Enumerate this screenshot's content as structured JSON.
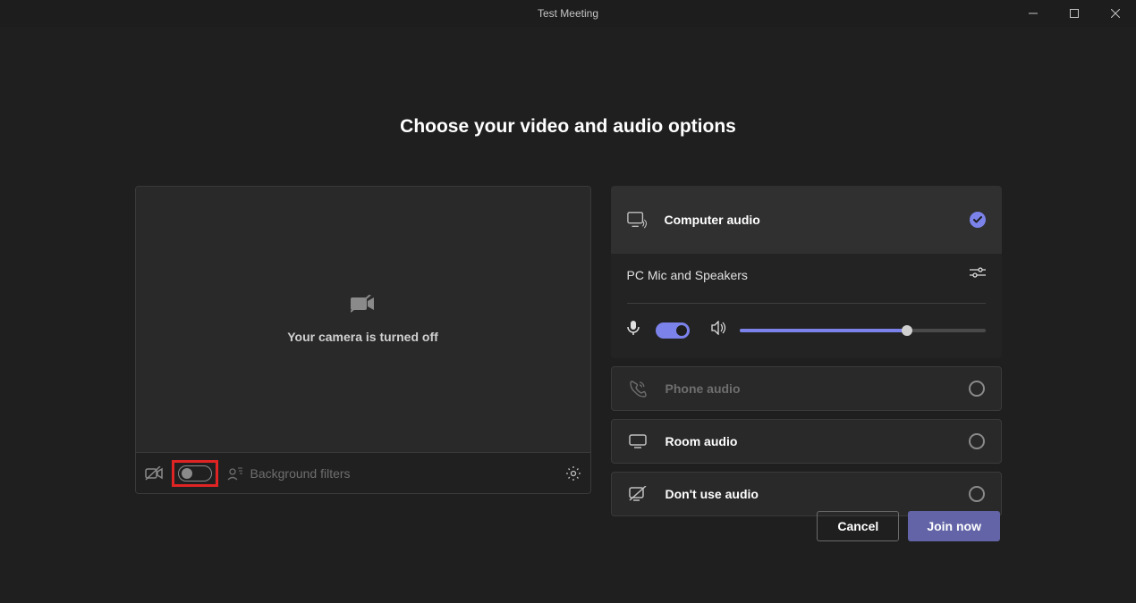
{
  "window": {
    "title": "Test Meeting"
  },
  "heading": "Choose your video and audio options",
  "video": {
    "camera_off_text": "Your camera is turned off",
    "background_filters_label": "Background filters",
    "camera_toggle_on": false
  },
  "audio": {
    "options": {
      "computer": "Computer audio",
      "phone": "Phone audio",
      "room": "Room audio",
      "none": "Don't use audio"
    },
    "selected": "computer",
    "device_label": "PC Mic and Speakers",
    "mic_toggle_on": true,
    "volume_percent": 68
  },
  "buttons": {
    "cancel": "Cancel",
    "join": "Join now"
  }
}
